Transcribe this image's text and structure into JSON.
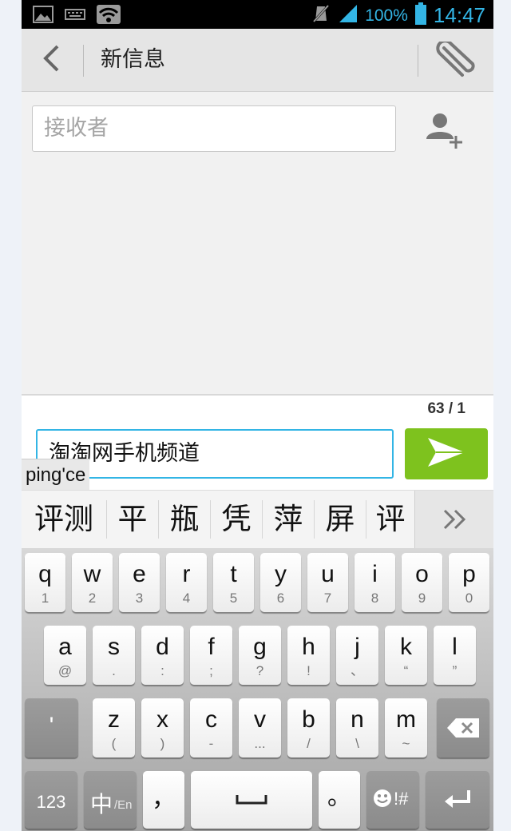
{
  "status_bar": {
    "battery_percent": "100%",
    "time": "14:47"
  },
  "header": {
    "title": "新信息"
  },
  "recipient": {
    "placeholder": "接收者"
  },
  "compose": {
    "counter": "63 / 1",
    "message_text": "淘淘网手机频道"
  },
  "ime": {
    "pinyin": "ping'ce",
    "candidates": [
      "评测",
      "平",
      "瓶",
      "凭",
      "萍",
      "屏",
      "评"
    ]
  },
  "keyboard": {
    "row1": [
      {
        "k": "q",
        "s": "1"
      },
      {
        "k": "w",
        "s": "2"
      },
      {
        "k": "e",
        "s": "3"
      },
      {
        "k": "r",
        "s": "4"
      },
      {
        "k": "t",
        "s": "5"
      },
      {
        "k": "y",
        "s": "6"
      },
      {
        "k": "u",
        "s": "7"
      },
      {
        "k": "i",
        "s": "8"
      },
      {
        "k": "o",
        "s": "9"
      },
      {
        "k": "p",
        "s": "0"
      }
    ],
    "row2": [
      {
        "k": "a",
        "s": "@"
      },
      {
        "k": "s",
        "s": "."
      },
      {
        "k": "d",
        "s": ":"
      },
      {
        "k": "f",
        "s": ";"
      },
      {
        "k": "g",
        "s": "?"
      },
      {
        "k": "h",
        "s": "!"
      },
      {
        "k": "j",
        "s": "、"
      },
      {
        "k": "k",
        "s": "“"
      },
      {
        "k": "l",
        "s": "”"
      }
    ],
    "row3": [
      {
        "k": "z",
        "s": "("
      },
      {
        "k": "x",
        "s": ")"
      },
      {
        "k": "c",
        "s": "-"
      },
      {
        "k": "v",
        "s": "..."
      },
      {
        "k": "b",
        "s": "/"
      },
      {
        "k": "n",
        "s": "\\"
      },
      {
        "k": "m",
        "s": "~"
      }
    ],
    "apostrophe": "'",
    "num_label": "123",
    "lang_main": "中",
    "lang_sub": "/En",
    "comma": "，",
    "period": "。",
    "emoji_extra": "!#"
  }
}
